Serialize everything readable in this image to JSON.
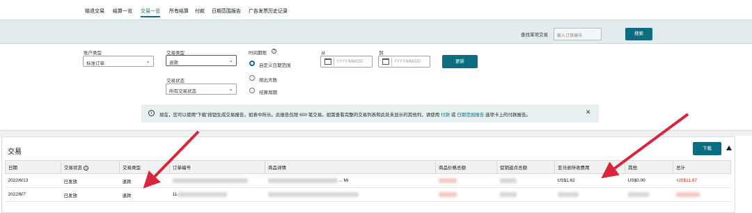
{
  "nav": {
    "items": [
      "赔退交易",
      "结算一览",
      "交易一览",
      "所有结算",
      "付款",
      "日期范围报告",
      "广告发票历史记录"
    ],
    "active_index": 2
  },
  "search": {
    "label": "查找某项交易",
    "placeholder": "输入订单编号",
    "button": "搜索"
  },
  "filters": {
    "account_type": {
      "label": "账户类型",
      "value": "标准订单"
    },
    "transaction_type": {
      "label": "交易类型",
      "value": "退款"
    },
    "transaction_status": {
      "label": "交易状态",
      "value": "所有交易状态"
    },
    "time_period": {
      "label": "时间期限",
      "options": [
        "自定义日期范围",
        "按出天数",
        "结算周期"
      ],
      "selected_index": 0
    },
    "from": {
      "label": "从",
      "placeholder": "YYYY/MM/DD"
    },
    "to": {
      "label": "到",
      "placeholder": "YYYY/MM/DD"
    },
    "apply_button": "更新"
  },
  "banner": {
    "text_before": "现在，您可以使用“下载”按钮生成交易报告，如表中所示。此报告仅限 600 笔交易。如需查看完整的交易列表和此处未显示的其他列，请使用",
    "link1": "付款",
    "text_mid": "或",
    "link2": "日期范围报告",
    "text_after": "选项卡上的付款报告。"
  },
  "transactions": {
    "title": "交易",
    "download_button": "下载",
    "columns": [
      "日期",
      "交易状态",
      "交易类型",
      "订单编号",
      "商品详情",
      "商品价格总额",
      "促销返点总额",
      "亚马逊所收费用",
      "其他",
      "总计"
    ],
    "rows": [
      {
        "date": "2022/6/13",
        "status": "已发放",
        "type": "退款",
        "order_id": "",
        "details": "... Mi",
        "price_total": "",
        "promo_total": "",
        "amazon_fees": "US$1.62",
        "other": "US$0.00",
        "total": "-US$11.87"
      },
      {
        "date": "2022/6/7",
        "status": "已发放",
        "type": "退款",
        "order_id": "11-",
        "details": "",
        "price_total": "",
        "promo_total": "",
        "amazon_fees": "",
        "other": "",
        "total": ""
      }
    ]
  },
  "colors": {
    "accent": "#0b6d81",
    "annotation_arrow": "#d7263d",
    "band_bg": "#e3ecec"
  }
}
